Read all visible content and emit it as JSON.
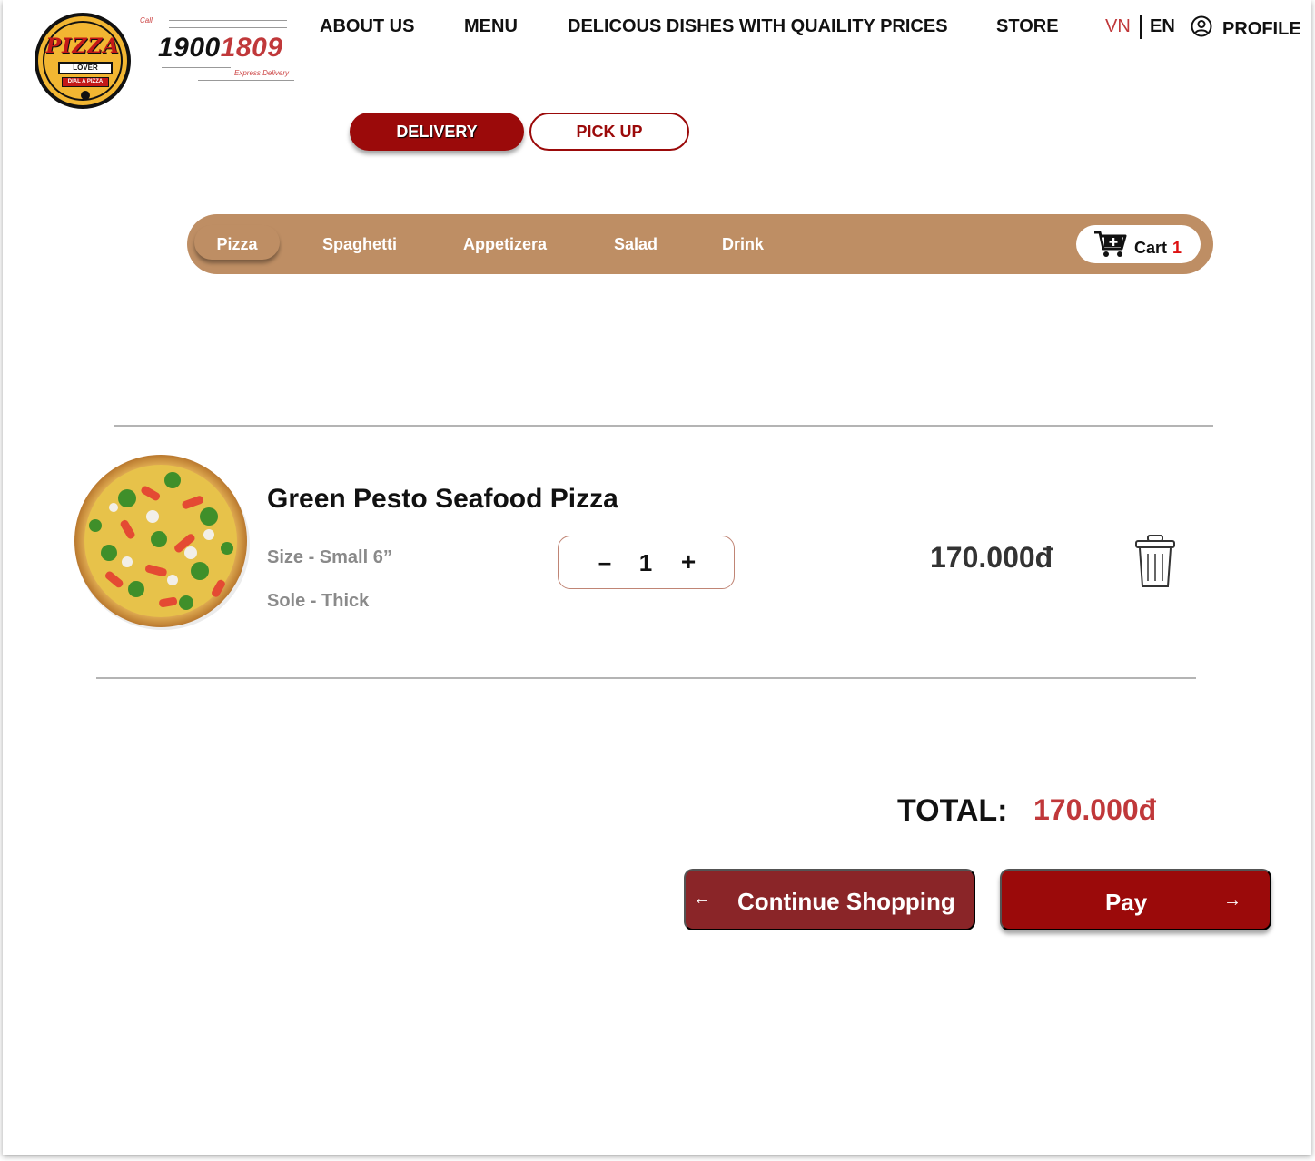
{
  "brand": {
    "logo_word": "PIZZA",
    "logo_sub": "LOVER",
    "logo_tag": "DIAL A PIZZA",
    "call_label": "Call",
    "phone_black": "1900",
    "phone_red": "1809",
    "express": "Express Delivery"
  },
  "nav": {
    "about": "ABOUT US",
    "menu": "MENU",
    "dishes": "DELICOUS DISHES WITH QUAILITY PRICES",
    "store": "STORE",
    "lang_vn": "VN",
    "lang_en": "EN",
    "profile": "PROFILE"
  },
  "order_type": {
    "delivery": "DELIVERY",
    "pickup": "PICK UP",
    "selected": "DELIVERY"
  },
  "categories": {
    "items": [
      "Pizza",
      "Spaghetti",
      "Appetizera",
      "Salad",
      "Drink"
    ],
    "active": "Pizza"
  },
  "cart": {
    "label": "Cart",
    "count": "1"
  },
  "cart_item": {
    "name": "Green Pesto Seafood Pizza",
    "size": "Size - Small 6”",
    "sole": "Sole - Thick",
    "quantity": "1",
    "minus": "–",
    "plus": "+",
    "price": "170.000đ"
  },
  "summary": {
    "total_label": "TOTAL:",
    "total_value": "170.000đ"
  },
  "actions": {
    "continue_arrow": "←",
    "continue_label": "Continue Shopping",
    "pay_label": "Pay",
    "pay_arrow": "→"
  },
  "colors": {
    "brand_red": "#9b0a0a",
    "price_red": "#c0383a",
    "category_bar": "#be8e64",
    "continue_button": "#8a2528"
  },
  "icons": {
    "profile": "user-circle-icon",
    "cart": "cart-add-icon",
    "delete": "trash-icon"
  }
}
